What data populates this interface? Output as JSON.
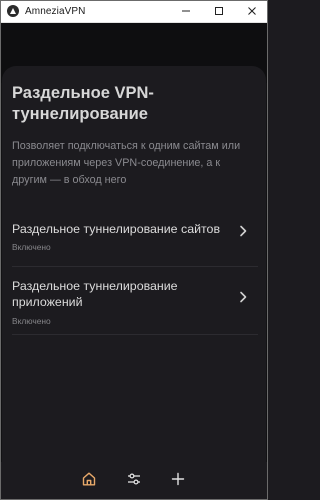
{
  "window": {
    "title": "AmneziaVPN",
    "controls": [
      "minimize-icon",
      "maximize-icon",
      "close-icon"
    ]
  },
  "page": {
    "title": "Раздельное VPN-туннелирование",
    "description": "Позволяет подключаться к одним сайтам или приложениям через VPN-соединение, а к другим — в обход него"
  },
  "items": [
    {
      "label": "Раздельное туннелирование сайтов",
      "status": "Включено",
      "icon": "chevron-right-icon"
    },
    {
      "label": "Раздельное туннелирование приложений",
      "status": "Включено",
      "icon": "chevron-right-icon"
    }
  ],
  "nav": {
    "items": [
      "home-icon",
      "settings-sliders-icon",
      "plus-icon"
    ],
    "active": "home-icon"
  },
  "colors": {
    "background": "#121214",
    "sheet": "#1c1b1f",
    "text_primary": "#d7d7d7",
    "text_secondary": "#8a8a8f",
    "accent_active": "#e8a96a"
  }
}
